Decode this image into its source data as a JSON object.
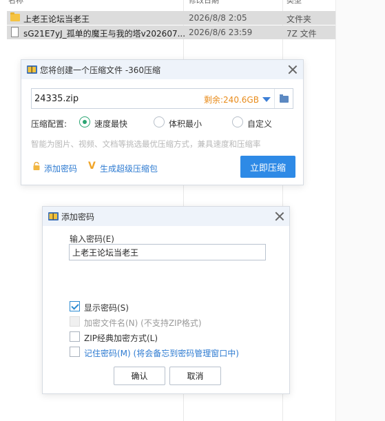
{
  "explorer": {
    "rows": [
      {
        "name": "上老王论坛当老王",
        "date": "2026/8/8 2:05",
        "type": "文件夹",
        "icon": "folder-icon"
      },
      {
        "name": "sG21E7yJ_孤单的魔王与我的塔v202607...",
        "date": "2026/8/6 23:59",
        "type": "7Z 文件",
        "icon": "document-icon"
      }
    ]
  },
  "compress_dialog": {
    "title": "您将创建一个压缩文件 -360压缩",
    "filename": "24335.zip",
    "free_space": "剩余:240.6GB",
    "config_label": "压缩配置:",
    "options": [
      {
        "label": "速度最快",
        "selected": true
      },
      {
        "label": "体积最小",
        "selected": false
      },
      {
        "label": "自定义",
        "selected": false
      }
    ],
    "hint": "智能为图片、视频、文档等挑选最优压缩方式，兼具速度和压缩率",
    "add_password_link": "添加密码",
    "super_package_link": "生成超级压缩包",
    "compress_button": "立即压缩",
    "accent_color": "#2e8ae6"
  },
  "password_dialog": {
    "title": "添加密码",
    "input_label": "输入密码(E)",
    "password_value": "上老王论坛当老王",
    "checkboxes": [
      {
        "label": "显示密码(S)",
        "checked": true,
        "disabled": false
      },
      {
        "label": "加密文件名(N) (不支持ZIP格式)",
        "checked": false,
        "disabled": true
      },
      {
        "label": "ZIP经典加密方式(L)",
        "checked": false,
        "disabled": false
      },
      {
        "label": "记住密码(M) (将会备忘到密码管理窗口中)",
        "checked": false,
        "disabled": false
      }
    ],
    "ok_button": "确认",
    "cancel_button": "取消"
  }
}
